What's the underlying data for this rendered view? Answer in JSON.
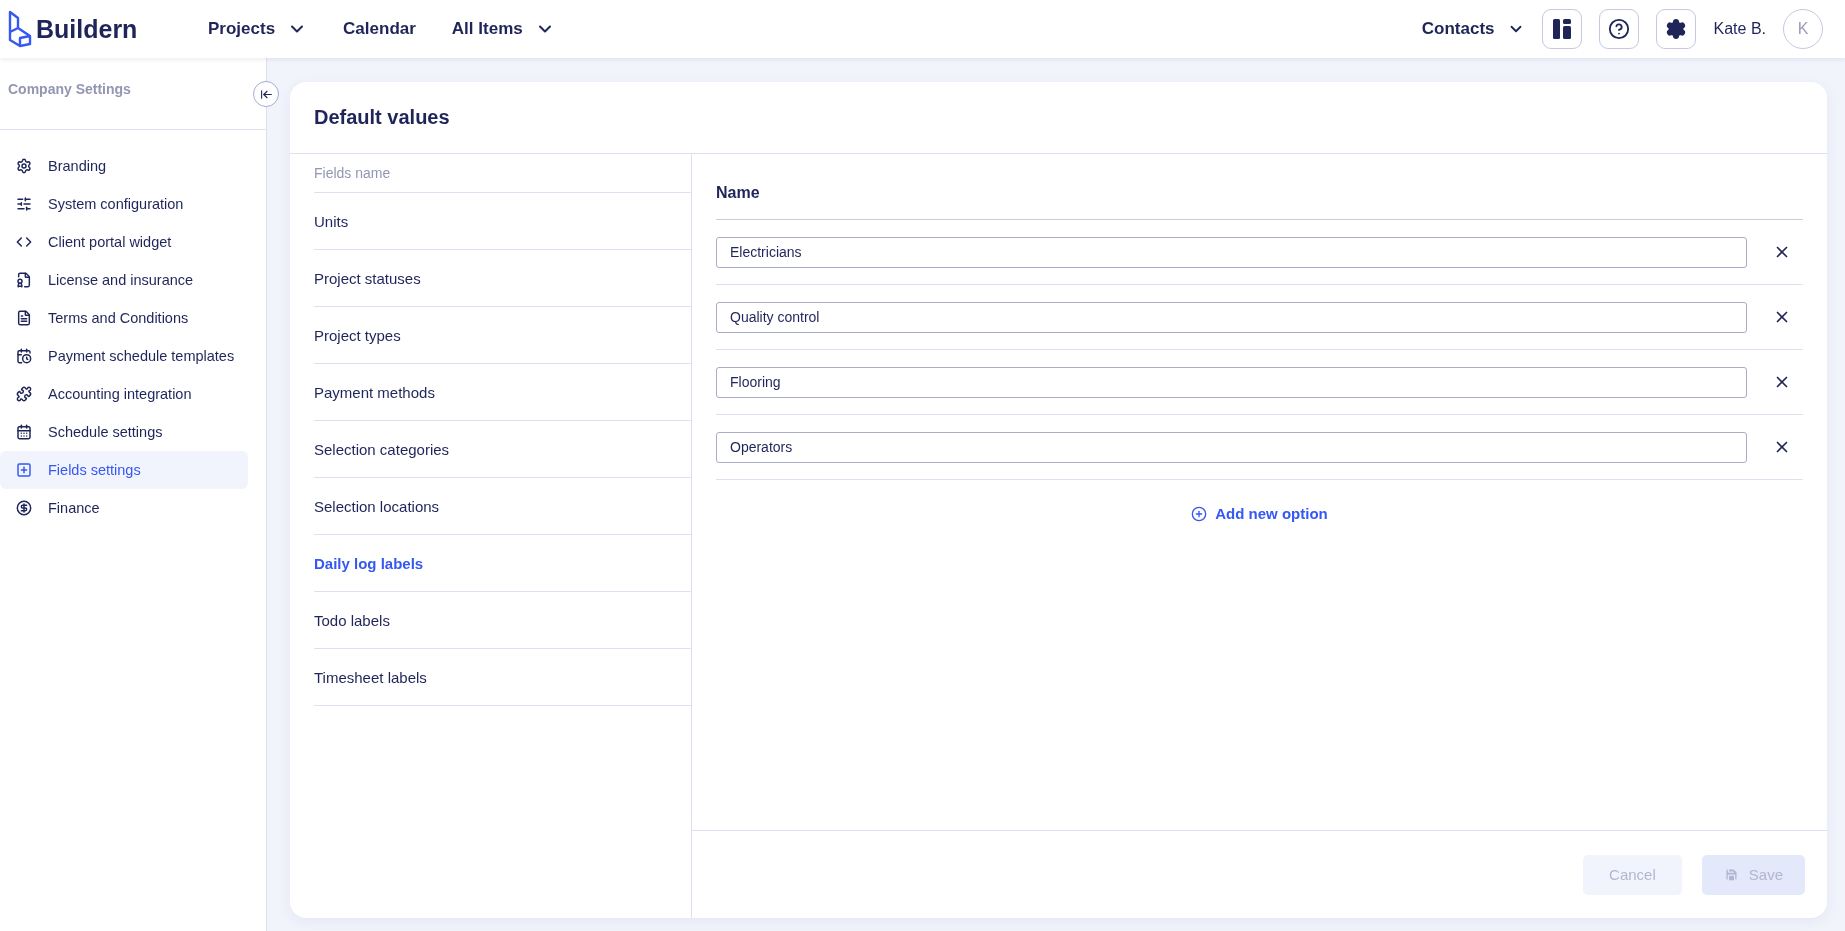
{
  "brand": {
    "name": "Buildern"
  },
  "nav": [
    {
      "label": "Projects",
      "dropdown": true
    },
    {
      "label": "Calendar",
      "dropdown": false
    },
    {
      "label": "All Items",
      "dropdown": true
    }
  ],
  "header_right": {
    "contacts": "Contacts",
    "user": "Kate B.",
    "avatar_initial": "K"
  },
  "sidebar": {
    "title": "Company Settings",
    "items": [
      {
        "label": "Branding",
        "selected": false
      },
      {
        "label": "System configuration",
        "selected": false
      },
      {
        "label": "Client portal widget",
        "selected": false
      },
      {
        "label": "License and insurance",
        "selected": false
      },
      {
        "label": "Terms and Conditions",
        "selected": false
      },
      {
        "label": "Payment schedule templates",
        "selected": false
      },
      {
        "label": "Accounting integration",
        "selected": false
      },
      {
        "label": "Schedule settings",
        "selected": false
      },
      {
        "label": "Fields settings",
        "selected": true
      },
      {
        "label": "Finance",
        "selected": false
      }
    ]
  },
  "card": {
    "title": "Default values",
    "fields_header": "Fields name",
    "fields": [
      {
        "label": "Units",
        "selected": false
      },
      {
        "label": "Project statuses",
        "selected": false
      },
      {
        "label": "Project types",
        "selected": false
      },
      {
        "label": "Payment methods",
        "selected": false
      },
      {
        "label": "Selection categories",
        "selected": false
      },
      {
        "label": "Selection locations",
        "selected": false
      },
      {
        "label": "Daily log labels",
        "selected": true
      },
      {
        "label": "Todo labels",
        "selected": false
      },
      {
        "label": "Timesheet labels",
        "selected": false
      }
    ],
    "options_header": "Name",
    "options": [
      {
        "value": "Electricians"
      },
      {
        "value": "Quality control"
      },
      {
        "value": "Flooring"
      },
      {
        "value": "Operators"
      }
    ],
    "add_option": "Add new option",
    "buttons": [
      {
        "label": "Cancel",
        "kind": "cancel",
        "disabled": true
      },
      {
        "label": "Save",
        "kind": "save",
        "disabled": true
      }
    ]
  }
}
